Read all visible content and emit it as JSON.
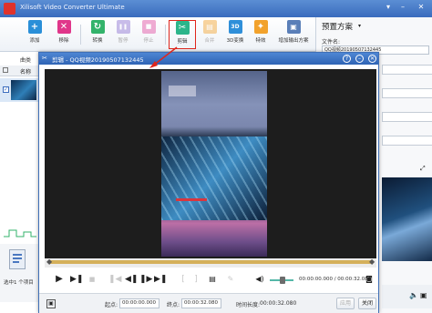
{
  "window": {
    "title": "Xilisoft Video Converter Ultimate"
  },
  "toolbar": {
    "items": [
      {
        "label": "添加",
        "icon": "add-icon",
        "color": "#2a8fd8",
        "glyph": "+"
      },
      {
        "label": "移除",
        "icon": "remove-icon",
        "color": "#e0368a",
        "glyph": "✕"
      },
      {
        "label": "转换",
        "icon": "convert-icon",
        "color": "#33b36b",
        "glyph": "↻"
      },
      {
        "label": "暂停",
        "icon": "pause-icon",
        "color": "#8a6fd1",
        "glyph": "❚❚"
      },
      {
        "label": "停止",
        "icon": "stop-icon",
        "color": "#e04aa0",
        "glyph": "■"
      },
      {
        "label": "剪辑",
        "icon": "clip-icon",
        "color": "#2bb58a",
        "glyph": "✂"
      },
      {
        "label": "合并",
        "icon": "merge-icon",
        "color": "#f2a22c",
        "glyph": "▤"
      },
      {
        "label": "3D变换",
        "icon": "3d-icon",
        "color": "#2f8fd9",
        "glyph": "3D"
      },
      {
        "label": "特效",
        "icon": "effects-icon",
        "color": "#f2a22c",
        "glyph": "✦"
      },
      {
        "label": "增加输出方案",
        "icon": "add-profile-icon",
        "color": "#5a7fb8",
        "glyph": "▣"
      }
    ]
  },
  "list": {
    "header_name": "名称",
    "left_label": "曲类"
  },
  "status": {
    "text": "选中1 个项目"
  },
  "preset": {
    "title": "预置方案",
    "filename_label": "文件名:",
    "filename_value": "QQ视频20190507132445"
  },
  "dialog": {
    "title": "剪辑 - QQ视频20190507132445",
    "timecode": "00:00:00.000 / 00:00:32.080",
    "start_label": "起点:",
    "start_value": "00:00:00.000",
    "end_label": "终点:",
    "end_value": "00:00:32.080",
    "duration_label": "时间长度:",
    "duration_value": "00:00:32.080",
    "apply_label": "应用",
    "close_label": "关闭"
  },
  "colors": {
    "title_blue": "#3a6cbd",
    "highlight_red": "#e0261c",
    "timeline_gold": "#d5b05a"
  }
}
